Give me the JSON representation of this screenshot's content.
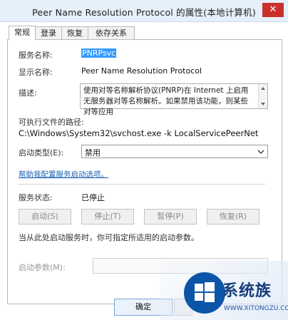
{
  "window": {
    "title": "Peer Name Resolution Protocol 的属性(本地计算机)",
    "close_glyph": "✕"
  },
  "tabs": [
    {
      "label": "常规"
    },
    {
      "label": "登录"
    },
    {
      "label": "恢复"
    },
    {
      "label": "依存关系"
    }
  ],
  "general": {
    "service_name_label": "服务名称:",
    "service_name_value": "PNRPsvc",
    "display_name_label": "显示名称:",
    "display_name_value": "Peer Name Resolution Protocol",
    "description_label": "描述:",
    "description_value": "使用对等名称解析协议(PNRP)在 Internet 上启用无服务器对等名称解析。如果禁用该功能，则某些对等应用",
    "exe_path_label": "可执行文件的路径:",
    "exe_path_value": "C:\\Windows\\System32\\svchost.exe -k LocalServicePeerNet",
    "startup_type_label": "启动类型(E):",
    "startup_type_value": "禁用",
    "help_link": "帮助我配置服务启动选项。",
    "status_label": "服务状态:",
    "status_value": "已停止",
    "buttons": {
      "start": "启动(S)",
      "stop": "停止(T)",
      "pause": "暂停(P)",
      "resume": "恢复(R)"
    },
    "start_params_hint": "当从此处启动服务时，你可指定所适用的启动参数。",
    "start_params_label": "启动参数(M):"
  },
  "footer": {
    "ok_label": "确定"
  },
  "watermark": {
    "brand": "系统族",
    "url": "WWW.XITONGZU.COM"
  },
  "colors": {
    "title_bar": "#e6f0fa",
    "close_button": "#c9302c",
    "selection": "#3399ff",
    "link": "#1a5fb4"
  }
}
